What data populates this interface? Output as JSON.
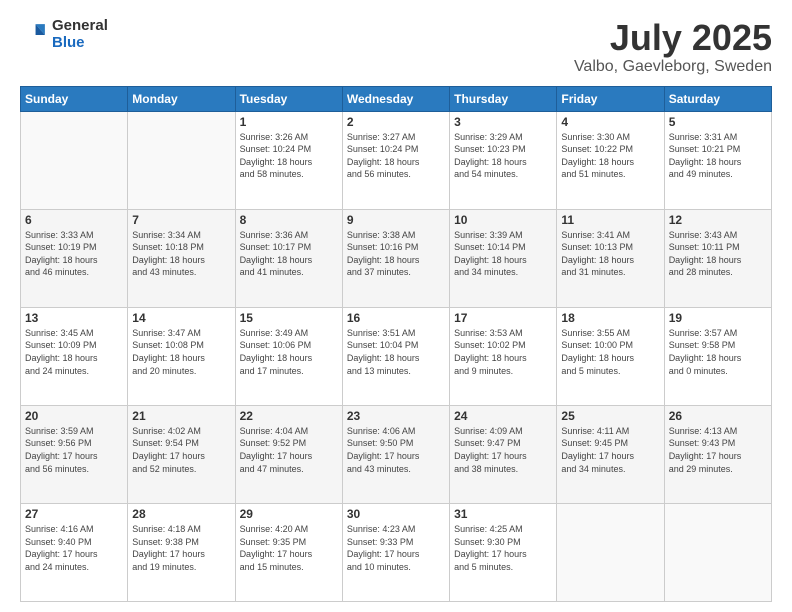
{
  "header": {
    "logo_general": "General",
    "logo_blue": "Blue",
    "title": "July 2025",
    "subtitle": "Valbo, Gaevleborg, Sweden"
  },
  "days_of_week": [
    "Sunday",
    "Monday",
    "Tuesday",
    "Wednesday",
    "Thursday",
    "Friday",
    "Saturday"
  ],
  "weeks": [
    [
      {
        "day": "",
        "info": ""
      },
      {
        "day": "",
        "info": ""
      },
      {
        "day": "1",
        "info": "Sunrise: 3:26 AM\nSunset: 10:24 PM\nDaylight: 18 hours\nand 58 minutes."
      },
      {
        "day": "2",
        "info": "Sunrise: 3:27 AM\nSunset: 10:24 PM\nDaylight: 18 hours\nand 56 minutes."
      },
      {
        "day": "3",
        "info": "Sunrise: 3:29 AM\nSunset: 10:23 PM\nDaylight: 18 hours\nand 54 minutes."
      },
      {
        "day": "4",
        "info": "Sunrise: 3:30 AM\nSunset: 10:22 PM\nDaylight: 18 hours\nand 51 minutes."
      },
      {
        "day": "5",
        "info": "Sunrise: 3:31 AM\nSunset: 10:21 PM\nDaylight: 18 hours\nand 49 minutes."
      }
    ],
    [
      {
        "day": "6",
        "info": "Sunrise: 3:33 AM\nSunset: 10:19 PM\nDaylight: 18 hours\nand 46 minutes."
      },
      {
        "day": "7",
        "info": "Sunrise: 3:34 AM\nSunset: 10:18 PM\nDaylight: 18 hours\nand 43 minutes."
      },
      {
        "day": "8",
        "info": "Sunrise: 3:36 AM\nSunset: 10:17 PM\nDaylight: 18 hours\nand 41 minutes."
      },
      {
        "day": "9",
        "info": "Sunrise: 3:38 AM\nSunset: 10:16 PM\nDaylight: 18 hours\nand 37 minutes."
      },
      {
        "day": "10",
        "info": "Sunrise: 3:39 AM\nSunset: 10:14 PM\nDaylight: 18 hours\nand 34 minutes."
      },
      {
        "day": "11",
        "info": "Sunrise: 3:41 AM\nSunset: 10:13 PM\nDaylight: 18 hours\nand 31 minutes."
      },
      {
        "day": "12",
        "info": "Sunrise: 3:43 AM\nSunset: 10:11 PM\nDaylight: 18 hours\nand 28 minutes."
      }
    ],
    [
      {
        "day": "13",
        "info": "Sunrise: 3:45 AM\nSunset: 10:09 PM\nDaylight: 18 hours\nand 24 minutes."
      },
      {
        "day": "14",
        "info": "Sunrise: 3:47 AM\nSunset: 10:08 PM\nDaylight: 18 hours\nand 20 minutes."
      },
      {
        "day": "15",
        "info": "Sunrise: 3:49 AM\nSunset: 10:06 PM\nDaylight: 18 hours\nand 17 minutes."
      },
      {
        "day": "16",
        "info": "Sunrise: 3:51 AM\nSunset: 10:04 PM\nDaylight: 18 hours\nand 13 minutes."
      },
      {
        "day": "17",
        "info": "Sunrise: 3:53 AM\nSunset: 10:02 PM\nDaylight: 18 hours\nand 9 minutes."
      },
      {
        "day": "18",
        "info": "Sunrise: 3:55 AM\nSunset: 10:00 PM\nDaylight: 18 hours\nand 5 minutes."
      },
      {
        "day": "19",
        "info": "Sunrise: 3:57 AM\nSunset: 9:58 PM\nDaylight: 18 hours\nand 0 minutes."
      }
    ],
    [
      {
        "day": "20",
        "info": "Sunrise: 3:59 AM\nSunset: 9:56 PM\nDaylight: 17 hours\nand 56 minutes."
      },
      {
        "day": "21",
        "info": "Sunrise: 4:02 AM\nSunset: 9:54 PM\nDaylight: 17 hours\nand 52 minutes."
      },
      {
        "day": "22",
        "info": "Sunrise: 4:04 AM\nSunset: 9:52 PM\nDaylight: 17 hours\nand 47 minutes."
      },
      {
        "day": "23",
        "info": "Sunrise: 4:06 AM\nSunset: 9:50 PM\nDaylight: 17 hours\nand 43 minutes."
      },
      {
        "day": "24",
        "info": "Sunrise: 4:09 AM\nSunset: 9:47 PM\nDaylight: 17 hours\nand 38 minutes."
      },
      {
        "day": "25",
        "info": "Sunrise: 4:11 AM\nSunset: 9:45 PM\nDaylight: 17 hours\nand 34 minutes."
      },
      {
        "day": "26",
        "info": "Sunrise: 4:13 AM\nSunset: 9:43 PM\nDaylight: 17 hours\nand 29 minutes."
      }
    ],
    [
      {
        "day": "27",
        "info": "Sunrise: 4:16 AM\nSunset: 9:40 PM\nDaylight: 17 hours\nand 24 minutes."
      },
      {
        "day": "28",
        "info": "Sunrise: 4:18 AM\nSunset: 9:38 PM\nDaylight: 17 hours\nand 19 minutes."
      },
      {
        "day": "29",
        "info": "Sunrise: 4:20 AM\nSunset: 9:35 PM\nDaylight: 17 hours\nand 15 minutes."
      },
      {
        "day": "30",
        "info": "Sunrise: 4:23 AM\nSunset: 9:33 PM\nDaylight: 17 hours\nand 10 minutes."
      },
      {
        "day": "31",
        "info": "Sunrise: 4:25 AM\nSunset: 9:30 PM\nDaylight: 17 hours\nand 5 minutes."
      },
      {
        "day": "",
        "info": ""
      },
      {
        "day": "",
        "info": ""
      }
    ]
  ]
}
